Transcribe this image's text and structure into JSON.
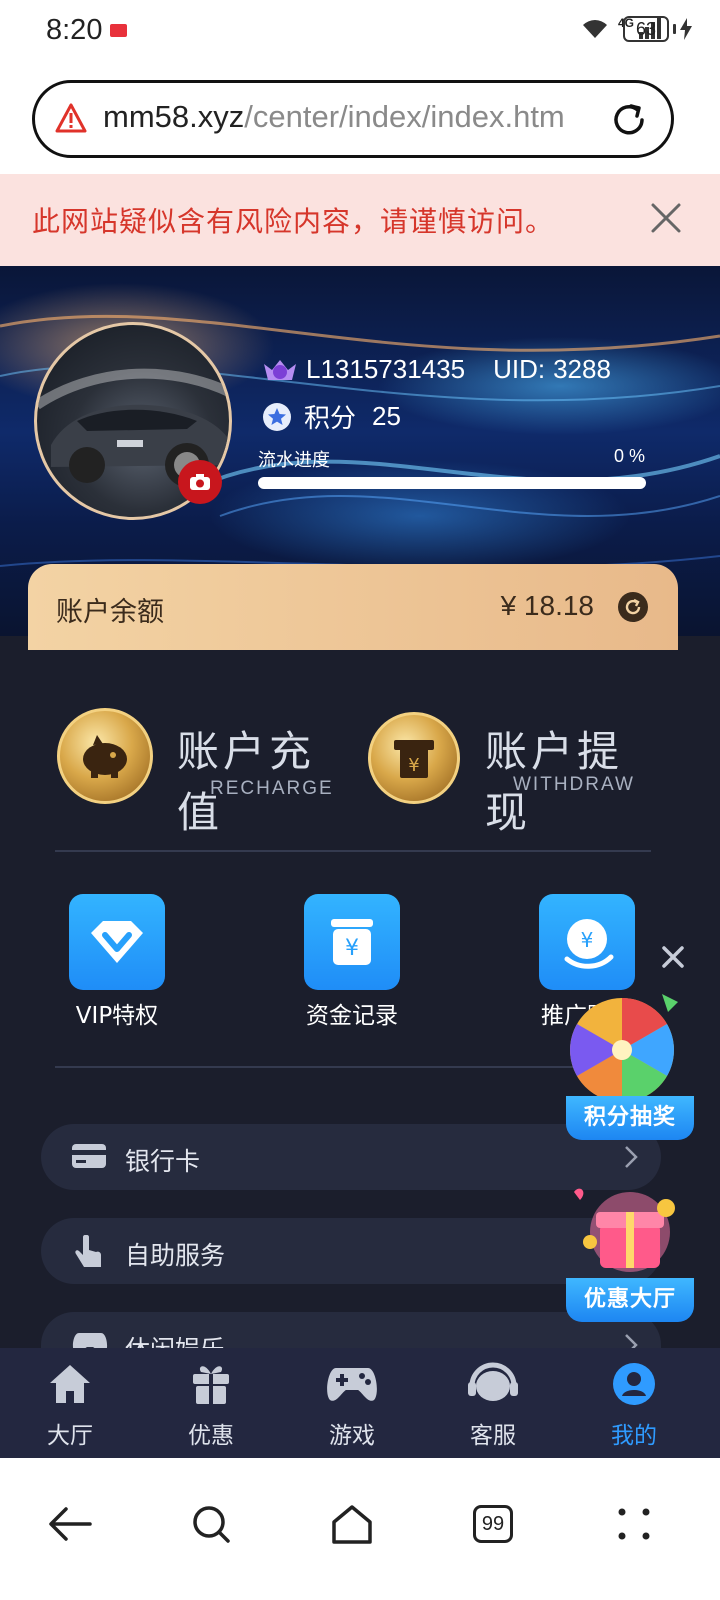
{
  "status_bar": {
    "time": "8:20",
    "battery": "63",
    "network": "4G"
  },
  "browser": {
    "url_host": "mm58.xyz",
    "url_path": "/center/index/index.htm",
    "risk_warning": "此网站疑似含有风险内容，请谨慎访问。"
  },
  "profile": {
    "username": "L1315731435",
    "uid_label": "UID:",
    "uid_value": "3288",
    "points_label": "积分",
    "points_value": "25",
    "flow_label": "流水进度",
    "flow_percent_text": "0 %",
    "flow_progress": 0
  },
  "balance": {
    "label": "账户余额",
    "amount": "¥ 18.18"
  },
  "actions": {
    "recharge_title": "账户充值",
    "recharge_sub": "RECHARGE",
    "withdraw_title": "账户提现",
    "withdraw_sub": "WITHDRAW"
  },
  "grid": [
    {
      "label": "VIP特权",
      "icon": "diamond-icon"
    },
    {
      "label": "资金记录",
      "icon": "fund-record-icon"
    },
    {
      "label": "推广赚钱",
      "icon": "promote-icon"
    }
  ],
  "menu": [
    {
      "label": "银行卡",
      "icon": "bank-card-icon"
    },
    {
      "label": "自助服务",
      "icon": "self-service-icon"
    },
    {
      "label": "休闲娱乐",
      "icon": "gamepad-icon"
    }
  ],
  "floating": {
    "lottery_label": "积分抽奖",
    "promo_label": "优惠大厅"
  },
  "bottom_nav": [
    {
      "label": "大厅",
      "icon": "home-icon"
    },
    {
      "label": "优惠",
      "icon": "gift-icon"
    },
    {
      "label": "游戏",
      "icon": "gamepad-icon"
    },
    {
      "label": "客服",
      "icon": "headset-icon"
    },
    {
      "label": "我的",
      "icon": "user-icon",
      "active": true
    }
  ],
  "system_nav": {
    "tabs_count": "99"
  },
  "colors": {
    "accent": "#2f9bff",
    "danger": "#d6362b",
    "gold": "#e8b98a",
    "bg": "#1b1e2c"
  }
}
